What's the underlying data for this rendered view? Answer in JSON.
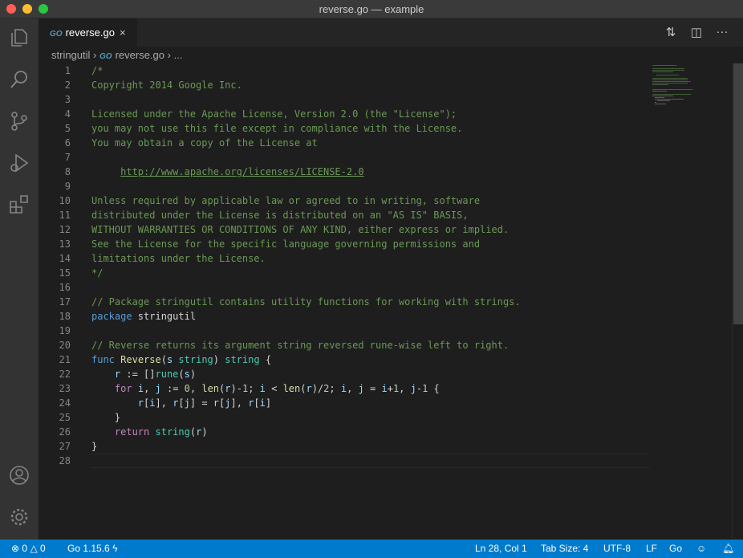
{
  "window": {
    "title": "reverse.go — example"
  },
  "tab": {
    "icon": "go-file-icon",
    "icon_text": "GO",
    "label": "reverse.go",
    "close": "×"
  },
  "breadcrumb": {
    "folder": "stringutil",
    "file": "reverse.go",
    "more": "..."
  },
  "lines": [
    [
      [
        "c",
        "/*"
      ]
    ],
    [
      [
        "c",
        "Copyright 2014 Google Inc."
      ]
    ],
    [],
    [
      [
        "c",
        "Licensed under the Apache License, Version 2.0 (the \"License\");"
      ]
    ],
    [
      [
        "c",
        "you may not use this file except in compliance with the License."
      ]
    ],
    [
      [
        "c",
        "You may obtain a copy of the License at"
      ]
    ],
    [],
    [
      [
        "c",
        "     "
      ],
      [
        "u",
        "http://www.apache.org/licenses/LICENSE-2.0"
      ]
    ],
    [],
    [
      [
        "c",
        "Unless required by applicable law or agreed to in writing, software"
      ]
    ],
    [
      [
        "c",
        "distributed under the License is distributed on an \"AS IS\" BASIS,"
      ]
    ],
    [
      [
        "c",
        "WITHOUT WARRANTIES OR CONDITIONS OF ANY KIND, either express or implied."
      ]
    ],
    [
      [
        "c",
        "See the License for the specific language governing permissions and"
      ]
    ],
    [
      [
        "c",
        "limitations under the License."
      ]
    ],
    [
      [
        "c",
        "*/"
      ]
    ],
    [],
    [
      [
        "c",
        "// Package stringutil contains utility functions for working with strings."
      ]
    ],
    [
      [
        "k",
        "package"
      ],
      [
        "p",
        " stringutil"
      ]
    ],
    [],
    [
      [
        "c",
        "// Reverse returns its argument string reversed rune-wise left to right."
      ]
    ],
    [
      [
        "k",
        "func"
      ],
      [
        "p",
        " "
      ],
      [
        "f",
        "Reverse"
      ],
      [
        "p",
        "("
      ],
      [
        "v",
        "s"
      ],
      [
        "p",
        " "
      ],
      [
        "t",
        "string"
      ],
      [
        "p",
        ") "
      ],
      [
        "t",
        "string"
      ],
      [
        "p",
        " {"
      ]
    ],
    [
      [
        "p",
        "    "
      ],
      [
        "v",
        "r"
      ],
      [
        "p",
        " := []"
      ],
      [
        "t",
        "rune"
      ],
      [
        "p",
        "("
      ],
      [
        "v",
        "s"
      ],
      [
        "p",
        ")"
      ]
    ],
    [
      [
        "p",
        "    "
      ],
      [
        "kw",
        "for"
      ],
      [
        "p",
        " "
      ],
      [
        "v",
        "i"
      ],
      [
        "p",
        ", "
      ],
      [
        "v",
        "j"
      ],
      [
        "p",
        " := "
      ],
      [
        "n",
        "0"
      ],
      [
        "p",
        ", "
      ],
      [
        "f",
        "len"
      ],
      [
        "p",
        "("
      ],
      [
        "v",
        "r"
      ],
      [
        "p",
        ")-"
      ],
      [
        "n",
        "1"
      ],
      [
        "p",
        "; "
      ],
      [
        "v",
        "i"
      ],
      [
        "p",
        " < "
      ],
      [
        "f",
        "len"
      ],
      [
        "p",
        "("
      ],
      [
        "v",
        "r"
      ],
      [
        "p",
        ")/"
      ],
      [
        "n",
        "2"
      ],
      [
        "p",
        "; "
      ],
      [
        "v",
        "i"
      ],
      [
        "p",
        ", "
      ],
      [
        "v",
        "j"
      ],
      [
        "p",
        " = "
      ],
      [
        "v",
        "i"
      ],
      [
        "p",
        "+"
      ],
      [
        "n",
        "1"
      ],
      [
        "p",
        ", "
      ],
      [
        "v",
        "j"
      ],
      [
        "p",
        "-"
      ],
      [
        "n",
        "1"
      ],
      [
        "p",
        " {"
      ]
    ],
    [
      [
        "p",
        "        "
      ],
      [
        "v",
        "r"
      ],
      [
        "p",
        "["
      ],
      [
        "v",
        "i"
      ],
      [
        "p",
        "], "
      ],
      [
        "v",
        "r"
      ],
      [
        "p",
        "["
      ],
      [
        "v",
        "j"
      ],
      [
        "p",
        "] = "
      ],
      [
        "v",
        "r"
      ],
      [
        "p",
        "["
      ],
      [
        "v",
        "j"
      ],
      [
        "p",
        "], "
      ],
      [
        "v",
        "r"
      ],
      [
        "p",
        "["
      ],
      [
        "v",
        "i"
      ],
      [
        "p",
        "]"
      ]
    ],
    [
      [
        "p",
        "    }"
      ]
    ],
    [
      [
        "p",
        "    "
      ],
      [
        "kw",
        "return"
      ],
      [
        "p",
        " "
      ],
      [
        "t",
        "string"
      ],
      [
        "p",
        "("
      ],
      [
        "v",
        "r"
      ],
      [
        "p",
        ")"
      ]
    ],
    [
      [
        "p",
        "}"
      ]
    ],
    []
  ],
  "status": {
    "errors": "0",
    "warnings": "0",
    "go_version": "Go 1.15.6",
    "position": "Ln 28, Col 1",
    "tab_size": "Tab Size: 4",
    "encoding": "UTF-8",
    "eol": "LF",
    "language": "Go"
  }
}
